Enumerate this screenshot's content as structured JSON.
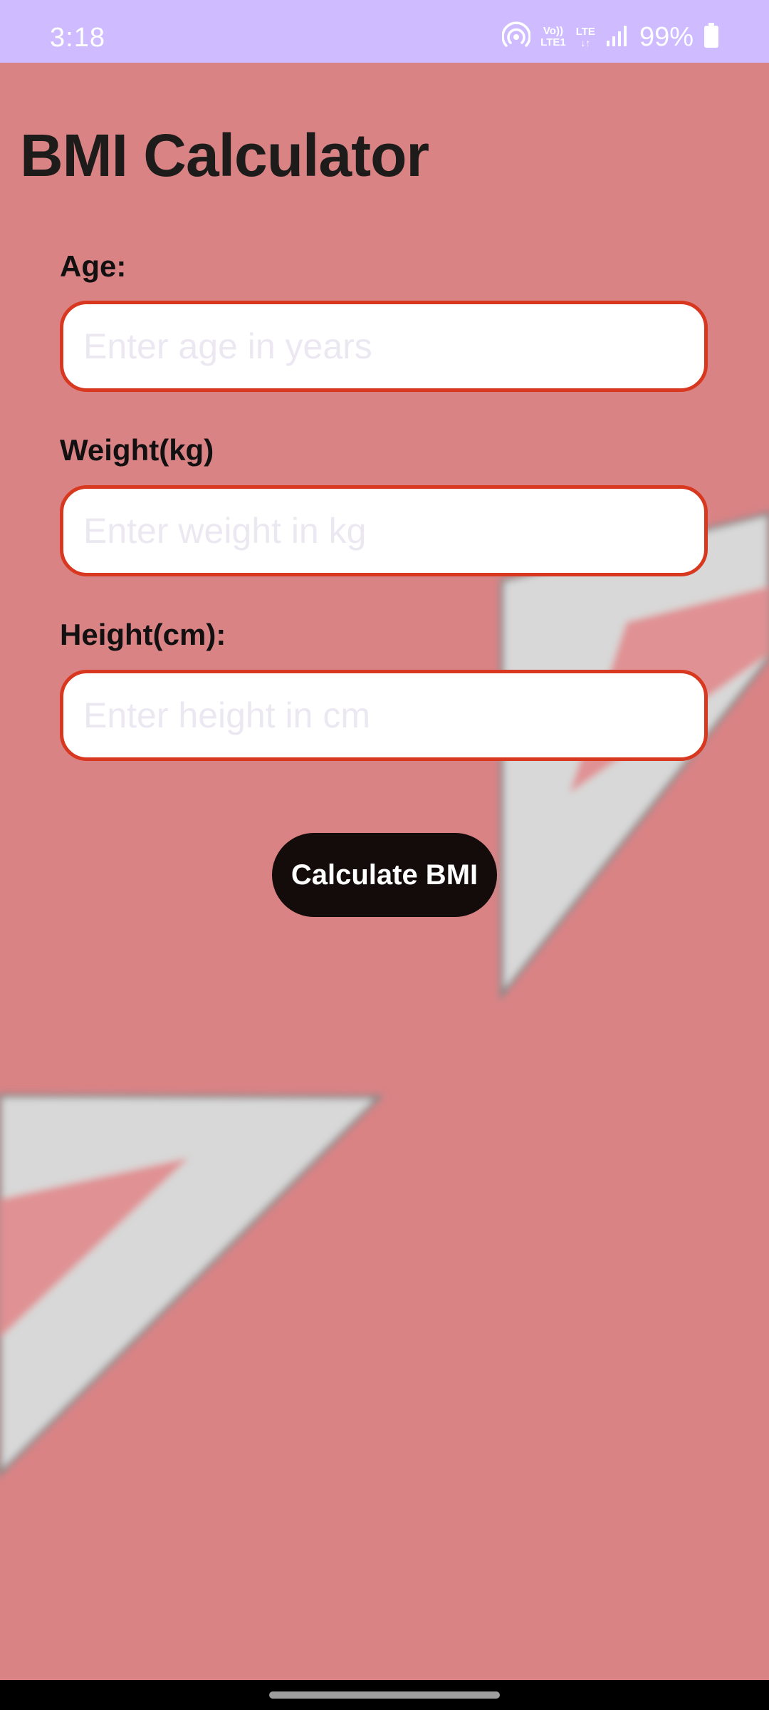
{
  "status_bar": {
    "time": "3:18",
    "volte_top": "Vo))",
    "volte_bottom": "LTE1",
    "lte_label": "LTE",
    "battery_percent": "99%",
    "icons": [
      "hotspot-icon",
      "volte-icon",
      "lte-data-icon",
      "signal-icon",
      "battery-icon"
    ]
  },
  "app": {
    "title": "BMI Calculator"
  },
  "form": {
    "age": {
      "label": "Age:",
      "placeholder": "Enter age in years",
      "value": ""
    },
    "weight": {
      "label": "Weight(kg)",
      "placeholder": "Enter weight in kg",
      "value": ""
    },
    "height": {
      "label": "Height(cm):",
      "placeholder": "Enter height in cm",
      "value": ""
    },
    "submit_label": "Calculate BMI"
  },
  "colors": {
    "status_bar": "#cfbbff",
    "background": "#d98385",
    "field_border": "#d8381f",
    "button": "#140b0b",
    "decor_arrow": "#d8d8d8",
    "decor_arrow_inner": "#e09193"
  }
}
